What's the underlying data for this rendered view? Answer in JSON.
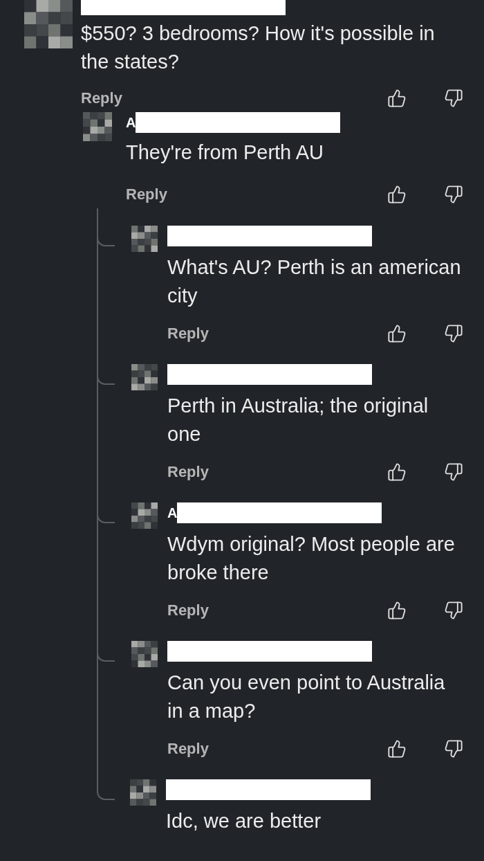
{
  "comments": [
    {
      "text": "$550? 3 bedrooms? How it's possible in the states?",
      "reply": "Reply",
      "children": [
        {
          "author": "A",
          "text": "They're from Perth AU",
          "reply": "Reply",
          "children": [
            {
              "text": "What's AU? Perth is an american city",
              "reply": "Reply"
            },
            {
              "text": "Perth in Australia; the original one",
              "reply": "Reply"
            },
            {
              "author": "A",
              "text": "Wdym original? Most people are broke there",
              "reply": "Reply"
            },
            {
              "text": "Can you even point to Australia in a map?",
              "reply": "Reply"
            },
            {
              "text": "Idc, we are better"
            }
          ]
        }
      ]
    }
  ]
}
